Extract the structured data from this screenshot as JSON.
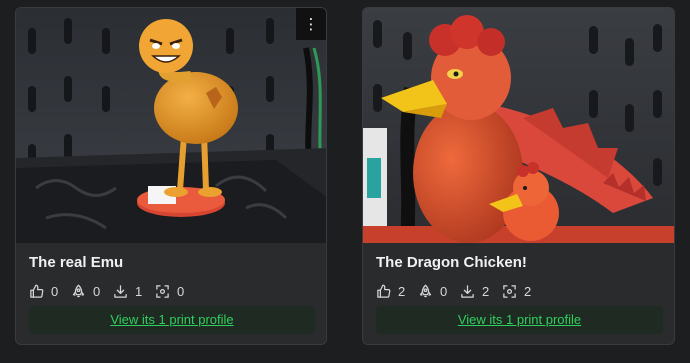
{
  "cards": [
    {
      "title": "The real Emu",
      "image_alt": "3D printed orange emu figure",
      "menu_icon": "more-vertical-icon",
      "stats": {
        "likes": "0",
        "boosts": "0",
        "downloads": "1",
        "prints": "0"
      },
      "profile_link": "View its 1 print profile"
    },
    {
      "title": "The Dragon Chicken!",
      "image_alt": "3D printed red dragon chicken figure",
      "stats": {
        "likes": "2",
        "boosts": "0",
        "downloads": "2",
        "prints": "2"
      },
      "profile_link": "View its 1 print profile"
    }
  ],
  "colors": {
    "background": "#1d1e20",
    "card": "#2a2b2d",
    "link": "#2fcf5e",
    "link_bg": "#1f2a22"
  },
  "menu_glyph": "⋮"
}
